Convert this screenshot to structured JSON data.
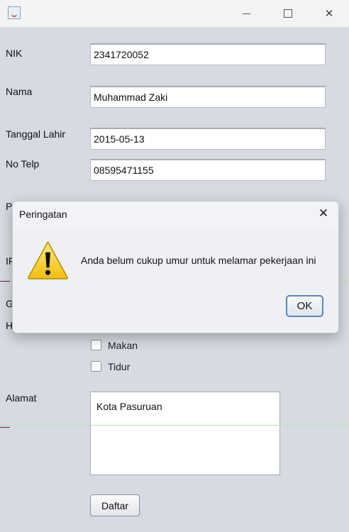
{
  "window": {
    "title": ""
  },
  "form": {
    "nik_label": "NIK",
    "nik_value": "2341720052",
    "nama_label": "Nama",
    "nama_value": "Muhammad Zaki",
    "tanggal_label": "Tanggal Lahir",
    "tanggal_value": "2015-05-13",
    "telp_label": "No Telp",
    "telp_value": "08595471155",
    "partial_label_1": "P",
    "partial_label_2": "IF",
    "partial_label_3": "G",
    "partial_label_4": "H",
    "hobi_options": [
      "Makan",
      "Tidur"
    ],
    "alamat_label": "Alamat",
    "alamat_value": "Kota Pasuruan",
    "submit_label": "Daftar"
  },
  "dialog": {
    "title": "Peringatan",
    "message": "Anda belum cukup umur untuk melamar pekerjaan ini",
    "ok_label": "OK",
    "icon": "warning-icon"
  },
  "colors": {
    "background": "#d7dae2",
    "accent": "#5c88b8",
    "warning": "#f2c811"
  }
}
